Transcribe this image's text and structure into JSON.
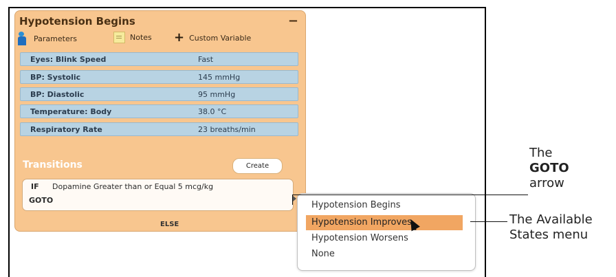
{
  "panel": {
    "title": "Hypotension Begins",
    "collapse_symbol": "−",
    "toolbar": {
      "parameters": "Parameters",
      "notes": "Notes",
      "custom_variable": "Custom Variable"
    },
    "parameters": [
      {
        "name": "Eyes: Blink Speed",
        "value": "Fast"
      },
      {
        "name": "BP: Systolic",
        "value": "145 mmHg"
      },
      {
        "name": "BP: Diastolic",
        "value": "95 mmHg"
      },
      {
        "name": "Temperature: Body",
        "value": "38.0 °C"
      },
      {
        "name": "Respiratory Rate",
        "value": "23 breaths/min"
      }
    ],
    "transitions_label": "Transitions",
    "create_label": "Create",
    "condition": {
      "if_label": "IF",
      "rule": "Dopamine Greater than or Equal 5 mcg/kg",
      "goto_label": "GOTO"
    },
    "else_label": "ELSE"
  },
  "menu": {
    "items": [
      "Hypotension Begins",
      "Hypotension Improves",
      "Hypotension Worsens",
      "None"
    ],
    "selected": "Hypotension Improves"
  },
  "callouts": {
    "goto_line1": "The",
    "goto_line2": "GOTO",
    "goto_line3": "arrow",
    "states_line1": "The Available",
    "states_line2": "States menu"
  },
  "colors": {
    "panel": "#f8c68f",
    "param_row": "#b8d3e3",
    "highlight": "#f1a662"
  },
  "icons": [
    "parameters-person-icon",
    "notes-icon",
    "plus-icon",
    "cursor-icon"
  ]
}
